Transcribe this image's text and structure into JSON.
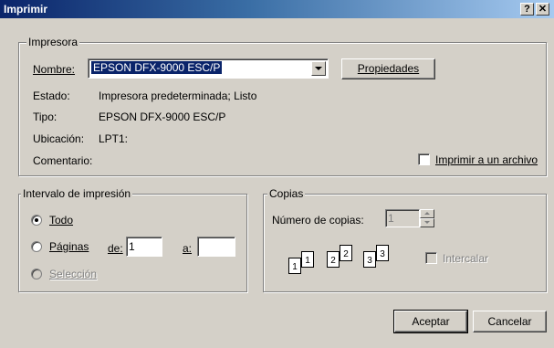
{
  "window": {
    "title": "Imprimir",
    "help_button": "?",
    "close_button": "✕"
  },
  "printer": {
    "group_label": "Impresora",
    "name_label": "Nombre:",
    "name_value": "EPSON DFX-9000 ESC/P",
    "properties_button": "Propiedades",
    "status_label": "Estado:",
    "status_value": "Impresora predeterminada; Listo",
    "type_label": "Tipo:",
    "type_value": "EPSON DFX-9000 ESC/P",
    "location_label": "Ubicación:",
    "location_value": "LPT1:",
    "comment_label": "Comentario:",
    "print_to_file_label": "Imprimir a un archivo"
  },
  "range": {
    "group_label": "Intervalo de impresión",
    "all_label": "Todo",
    "pages_label": "Páginas",
    "from_label": "de:",
    "from_value": "1",
    "to_label": "a:",
    "to_value": "",
    "selection_label": "Selección"
  },
  "copies": {
    "group_label": "Copias",
    "count_label": "Número de copias:",
    "count_value": "1",
    "collate_label": "Intercalar",
    "collate_pages": [
      "1",
      "1",
      "2",
      "2",
      "3",
      "3"
    ]
  },
  "footer": {
    "ok_button": "Aceptar",
    "cancel_button": "Cancelar"
  }
}
